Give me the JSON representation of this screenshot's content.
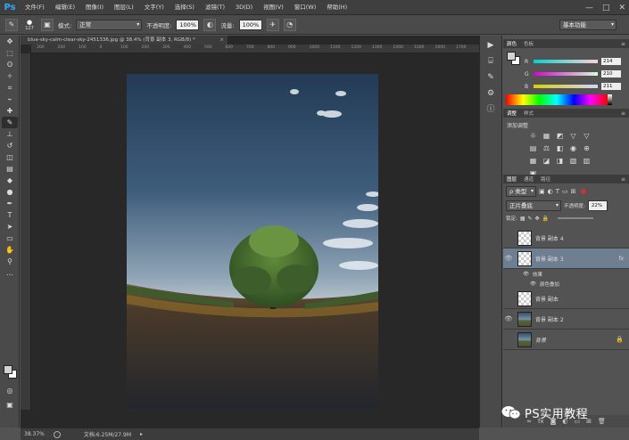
{
  "app": {
    "logo": "Ps",
    "menu": [
      "文件(F)",
      "编辑(E)",
      "图像(I)",
      "图层(L)",
      "文字(Y)",
      "选择(S)",
      "滤镜(T)",
      "3D(D)",
      "视图(V)",
      "窗口(W)",
      "帮助(H)"
    ],
    "window_controls": [
      "—",
      "□",
      "✕"
    ]
  },
  "options": {
    "brush_size": "127",
    "mode_label": "模式:",
    "mode_value": "正常",
    "opacity_label": "不透明度:",
    "opacity_value": "100%",
    "flow_label": "流量:",
    "flow_value": "100%",
    "workspace": "基本功能"
  },
  "document": {
    "tab_title": "blue-sky-calm-clear-sky-2451336.jpg @ 38.4% (背景 副本 3, RGB/8) *",
    "ruler_ticks": [
      "300",
      "200",
      "100",
      "0",
      "100",
      "200",
      "300",
      "400",
      "500",
      "600",
      "700",
      "800",
      "900",
      "1000",
      "1100",
      "1200",
      "1300",
      "1400",
      "1500",
      "1600",
      "1700"
    ]
  },
  "status": {
    "zoom": "38.37%",
    "doc_size": "文档:6.25M/27.9M"
  },
  "color_panel": {
    "tabs": [
      "颜色",
      "色板"
    ],
    "channels": [
      {
        "label": "R",
        "value": "214"
      },
      {
        "label": "G",
        "value": "210"
      },
      {
        "label": "B",
        "value": "211"
      }
    ],
    "fg_color": "#d6d2d3"
  },
  "adjustments_panel": {
    "tabs": [
      "调整",
      "样式"
    ],
    "title": "添加调整",
    "icons": [
      "brightness-icon",
      "levels-icon",
      "curves-icon",
      "exposure-icon",
      "vibrance-icon",
      "hue-sat-icon",
      "color-balance-icon",
      "black-white-icon",
      "photo-filter-icon",
      "channel-mixer-icon",
      "color-lookup-icon",
      "invert-icon",
      "posterize-icon",
      "threshold-icon",
      "gradient-map-icon",
      "selective-color-icon"
    ],
    "icon_glyphs": [
      "☼",
      "▦",
      "◩",
      "▽",
      "▽",
      "▤",
      "⚖",
      "◧",
      "◉",
      "⊕",
      "▦",
      "◪",
      "◨",
      "▧",
      "▥",
      "▣"
    ]
  },
  "layers_panel": {
    "tabs": [
      "图层",
      "通道",
      "路径"
    ],
    "filter_label": "ρ 类型",
    "blend_mode": "正片叠底",
    "opacity_label": "不透明度:",
    "opacity_value": "22%",
    "lock_label": "锁定:",
    "fill_label": "填充:",
    "fill_value": "100%",
    "layers": [
      {
        "name": "背景 副本 4",
        "thumb": "checker",
        "visible": false,
        "selected": false
      },
      {
        "name": "背景 副本 3",
        "thumb": "checker",
        "visible": true,
        "selected": true,
        "fx": "fx"
      },
      {
        "name": "背景 副本",
        "thumb": "checker",
        "visible": false,
        "selected": false
      },
      {
        "name": "背景 副本 2",
        "thumb": "photo",
        "visible": true,
        "selected": false
      },
      {
        "name": "背景",
        "thumb": "photo",
        "visible": false,
        "selected": false,
        "locked": true
      }
    ],
    "effects_label": "效果",
    "effect_item": "颜色叠加"
  },
  "watermark": {
    "text": "PS实用教程"
  }
}
